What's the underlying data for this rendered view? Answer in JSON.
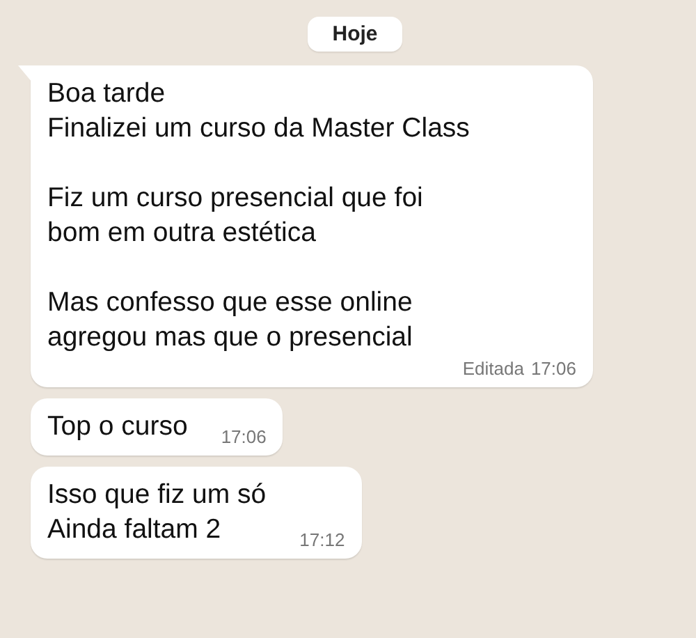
{
  "date_pill": "Hoje",
  "messages": [
    {
      "text": "Boa tarde\nFinalizei um curso da Master Class\n\nFiz um curso presencial que foi\nbom em outra estética\n\nMas confesso que esse online\nagregou mas que o presencial",
      "edited_label": "Editada",
      "time": "17:06",
      "tail": true
    },
    {
      "text": "Top o curso",
      "time": "17:06",
      "tail": false
    },
    {
      "text": "Isso que fiz um só\nAinda faltam 2",
      "time": "17:12",
      "tail": false
    }
  ]
}
